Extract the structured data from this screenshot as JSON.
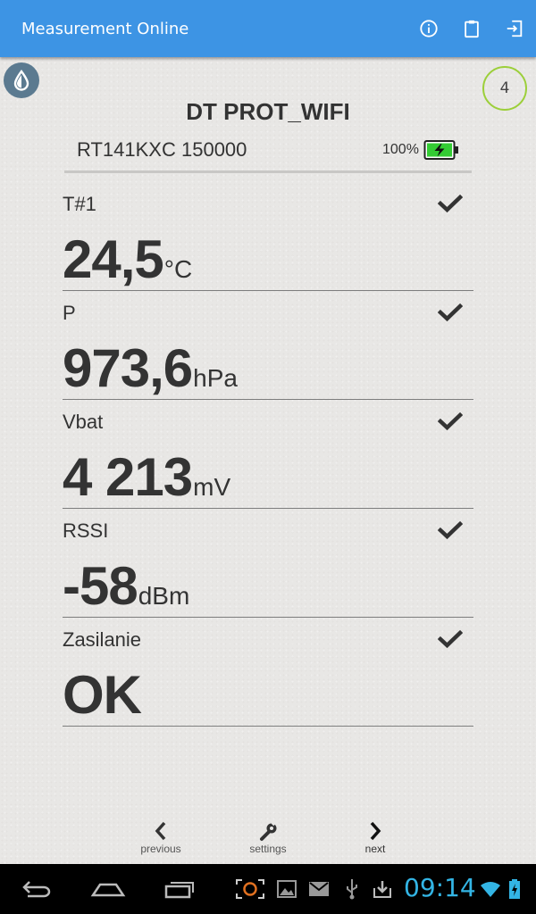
{
  "app": {
    "title": "Measurement Online",
    "actions": [
      {
        "icon": "info-icon"
      },
      {
        "icon": "clipboard-icon"
      },
      {
        "icon": "logout-icon"
      }
    ]
  },
  "colors": {
    "appbar": "#3d94e4",
    "accent_circle": "#9ccf3a",
    "battery": "#33cc33",
    "clock": "#33b5e5",
    "drop_button": "#5b7a90"
  },
  "device": {
    "count": "4",
    "name": "DT PROT_WIFI",
    "serial": "RT141KXC 150000",
    "battery_pct": "100%",
    "battery_level": 1.0
  },
  "measurements": [
    {
      "label": "T#1",
      "value": "24,5",
      "unit": "°C",
      "status": "ok"
    },
    {
      "label": "P",
      "value": "973,6",
      "unit": "hPa",
      "status": "ok"
    },
    {
      "label": "Vbat",
      "value": "4 213",
      "unit": "mV",
      "status": "ok"
    },
    {
      "label": "RSSI",
      "value": "-58",
      "unit": "dBm",
      "status": "ok"
    },
    {
      "label": "Zasilanie",
      "value": "OK",
      "unit": "",
      "status": "ok"
    }
  ],
  "nav": {
    "previous": "previous",
    "settings": "settings",
    "next": "next"
  },
  "system": {
    "time": "09:14"
  }
}
